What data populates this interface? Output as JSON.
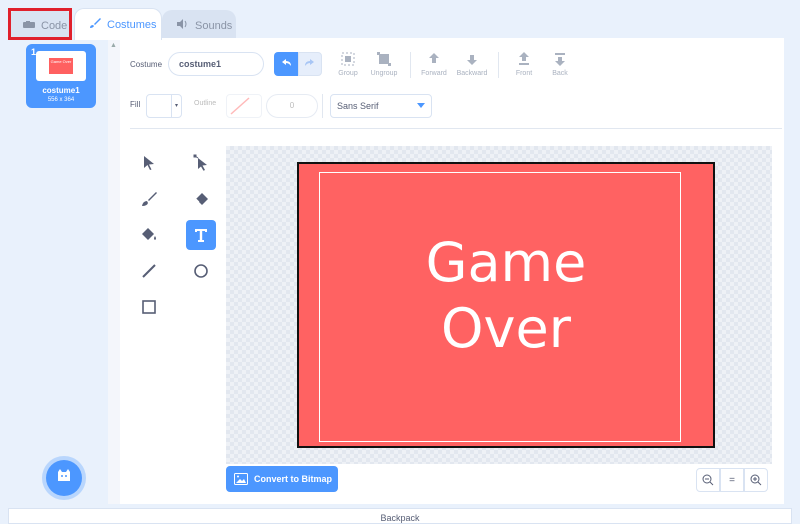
{
  "tabs": {
    "code": "Code",
    "costumes": "Costumes",
    "sounds": "Sounds"
  },
  "costume_list": {
    "items": [
      {
        "number": "1",
        "name": "costume1",
        "size": "556 x 364",
        "thumb_text": "Game Over"
      }
    ]
  },
  "toolbar": {
    "costume_label": "Costume",
    "costume_name": "costume1",
    "group": "Group",
    "ungroup": "Ungroup",
    "forward": "Forward",
    "backward": "Backward",
    "front": "Front",
    "back": "Back"
  },
  "style_row": {
    "fill_label": "Fill",
    "outline_label": "Outline",
    "outline_width": "0",
    "font": "Sans Serif"
  },
  "canvas": {
    "line1": "Game",
    "line2": "Over"
  },
  "bottom": {
    "convert": "Convert to Bitmap",
    "zoom_reset": "="
  },
  "footer": {
    "backpack": "Backpack"
  },
  "colors": {
    "accent": "#4c97ff",
    "costume_fill": "#ff6262",
    "highlight": "#e0202c"
  },
  "icons": [
    "code-icon",
    "brush-icon",
    "speaker-icon",
    "undo-icon",
    "redo-icon",
    "group-icon",
    "ungroup-icon",
    "forward-icon",
    "backward-icon",
    "front-icon",
    "back-icon",
    "select-icon",
    "reshape-icon",
    "brush-tool-icon",
    "eraser-icon",
    "fill-icon",
    "text-icon",
    "line-icon",
    "circle-icon",
    "rectangle-icon",
    "image-icon",
    "zoom-out-icon",
    "zoom-in-icon",
    "cat-icon"
  ]
}
